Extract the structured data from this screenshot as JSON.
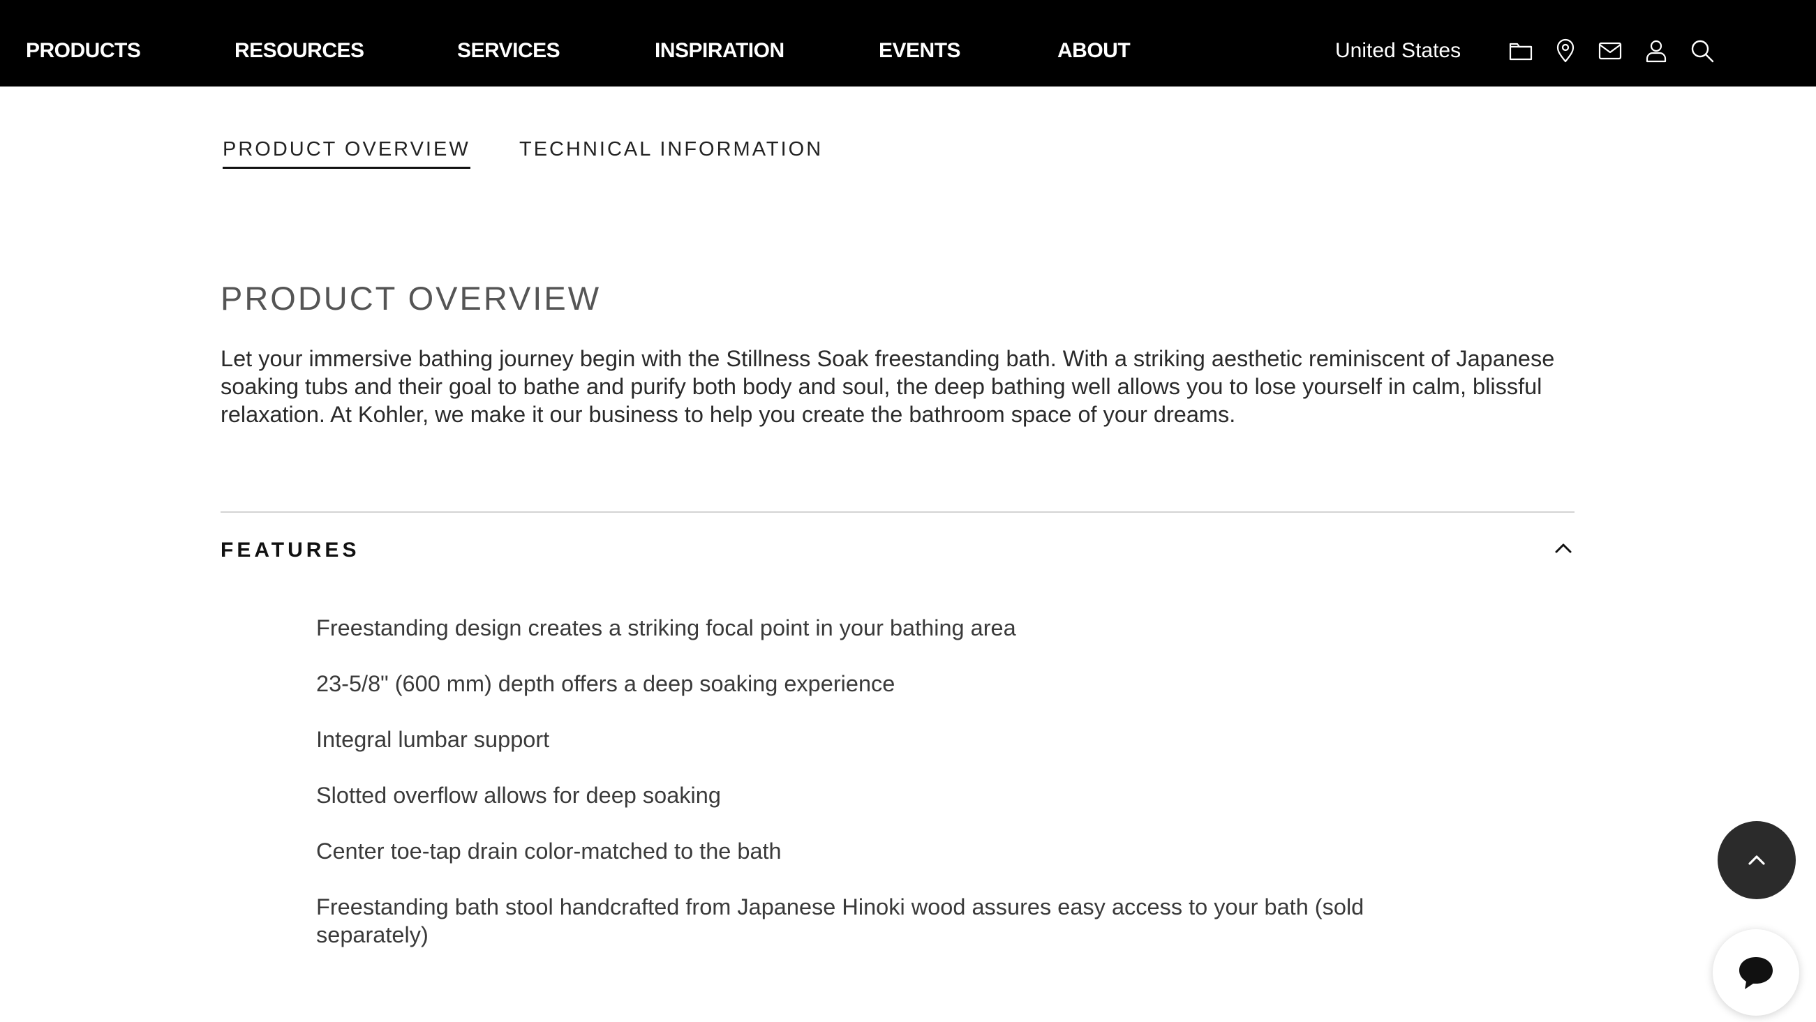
{
  "nav": {
    "items": [
      {
        "label": "PRODUCTS"
      },
      {
        "label": "RESOURCES"
      },
      {
        "label": "SERVICES"
      },
      {
        "label": "INSPIRATION"
      },
      {
        "label": "EVENTS"
      },
      {
        "label": "ABOUT"
      }
    ],
    "country": "United States",
    "icons": [
      "folder-icon",
      "location-pin-icon",
      "mail-icon",
      "user-icon",
      "search-icon"
    ]
  },
  "tabs": [
    {
      "label": "PRODUCT OVERVIEW",
      "active": true
    },
    {
      "label": "TECHNICAL INFORMATION",
      "active": false
    }
  ],
  "overview": {
    "title": "PRODUCT OVERVIEW",
    "text": "Let your immersive bathing journey begin with the Stillness Soak freestanding bath. With a striking aesthetic reminiscent of Japanese soaking tubs and their goal to bathe and purify both body and soul, the deep bathing well allows you to lose yourself in calm, blissful relaxation. At Kohler, we make it our business to help you create the bathroom space of your dreams."
  },
  "features": {
    "title": "FEATURES",
    "expanded": true,
    "items": [
      "Freestanding design creates a striking focal point in your bathing area",
      "23-5/8\" (600 mm) depth offers a deep soaking experience",
      "Integral lumbar support",
      "Slotted overflow allows for deep soaking",
      "Center toe-tap drain color-matched to the bath",
      "Freestanding bath stool handcrafted from Japanese Hinoki wood assures easy access to your bath (sold separately)"
    ]
  },
  "floating": {
    "back_to_top_icon": "chevron-up-icon",
    "chat_icon": "chat-bubble-icon"
  },
  "colors": {
    "nav_background": "#000000",
    "nav_text": "#ffffff",
    "back_to_top_bg": "#2b2b2b"
  }
}
